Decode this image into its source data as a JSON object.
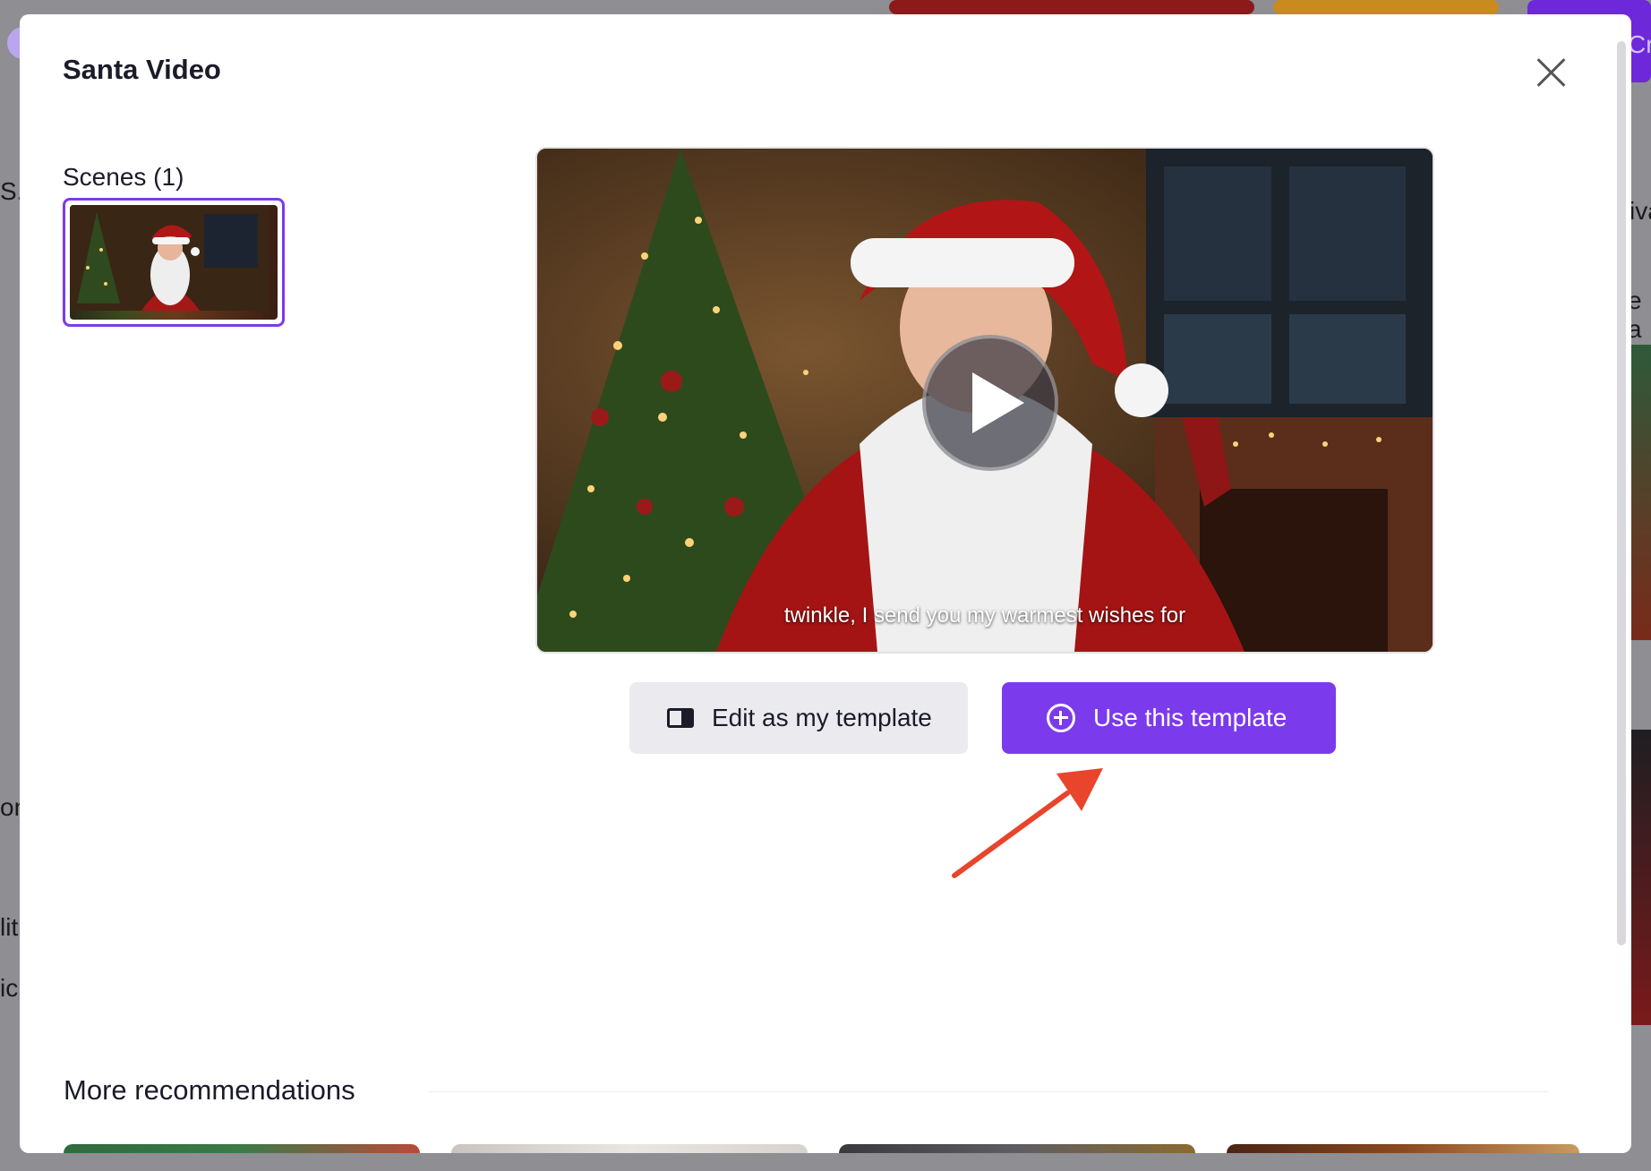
{
  "modal": {
    "title": "Santa Video",
    "close_icon": "close-icon",
    "scenes_label": "Scenes (1)",
    "video": {
      "subtitle": "twinkle, I send you my warmest wishes for"
    },
    "actions": {
      "edit_label": "Edit as my template",
      "use_label": "Use this template"
    },
    "more_recommendations_label": "More recommendations"
  },
  "background_fragments": {
    "top_right": "Cr",
    "left_1": "S...",
    "right_1": "iva",
    "right_2": "e a",
    "left_2": "on",
    "left_3": "lit",
    "left_4": "ic"
  },
  "colors": {
    "accent": "#7c3aed",
    "annotation_arrow": "#e8452c"
  }
}
